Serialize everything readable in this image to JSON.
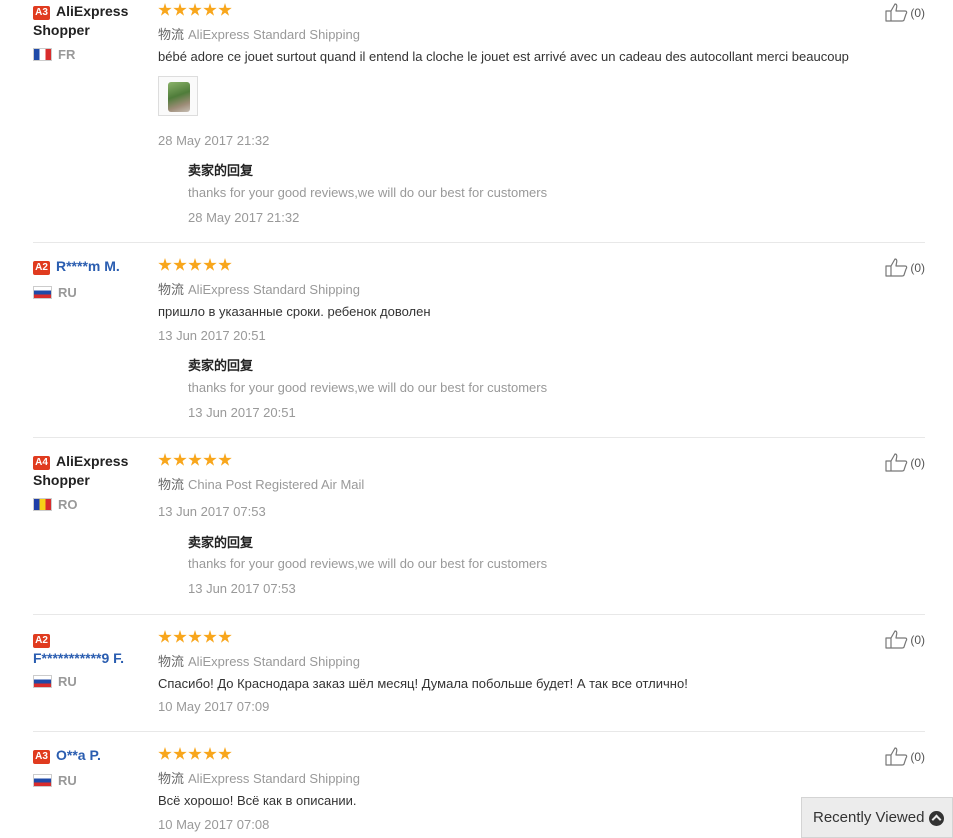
{
  "reviews": [
    {
      "badge": "A3",
      "name": "AliExpress Shopper",
      "country": "FR",
      "ship_label": "物流",
      "shipping": "AliExpress Standard Shipping",
      "text": "bébé adore ce jouet surtout quand il entend la cloche le jouet est arrivé avec un cadeau des autocollant merci beaucoup",
      "date": "28 May 2017 21:32",
      "reply_title": "卖家的回复",
      "reply_text": "thanks for your good reviews,we will do our best for customers",
      "reply_date": "28 May 2017 21:32",
      "likes": "(0)"
    },
    {
      "badge": "A2",
      "name": "R****m M.",
      "country": "RU",
      "ship_label": "物流",
      "shipping": "AliExpress Standard Shipping",
      "text": "пришло в указанные сроки. ребенок доволен",
      "date": "13 Jun 2017 20:51",
      "reply_title": "卖家的回复",
      "reply_text": "thanks for your good reviews,we will do our best for customers",
      "reply_date": "13 Jun 2017 20:51",
      "likes": "(0)"
    },
    {
      "badge": "A4",
      "name": "AliExpress Shopper",
      "country": "RO",
      "ship_label": "物流",
      "shipping": "China Post Registered Air Mail",
      "date": "13 Jun 2017 07:53",
      "reply_title": "卖家的回复",
      "reply_text": "thanks for your good reviews,we will do our best for customers",
      "reply_date": "13 Jun 2017 07:53",
      "likes": "(0)"
    },
    {
      "badge": "A2",
      "name": "F***********9 F.",
      "country": "RU",
      "ship_label": "物流",
      "shipping": "AliExpress Standard Shipping",
      "text": "Спасибо! До Краснодара заказ шёл месяц! Думала побольше будет! А так все отлично!",
      "date": "10 May 2017 07:09",
      "likes": "(0)"
    },
    {
      "badge": "A3",
      "name": "O**a P.",
      "country": "RU",
      "ship_label": "物流",
      "shipping": "AliExpress Standard Shipping",
      "text": "Всё хорошо! Всё как в описании.",
      "date": "10 May 2017 07:08",
      "likes": "(0)"
    }
  ],
  "recently_viewed": "Recently Viewed",
  "colors": {
    "badge": "#e03b1f",
    "stars": "#f8a61c",
    "link": "#2a5db0"
  }
}
